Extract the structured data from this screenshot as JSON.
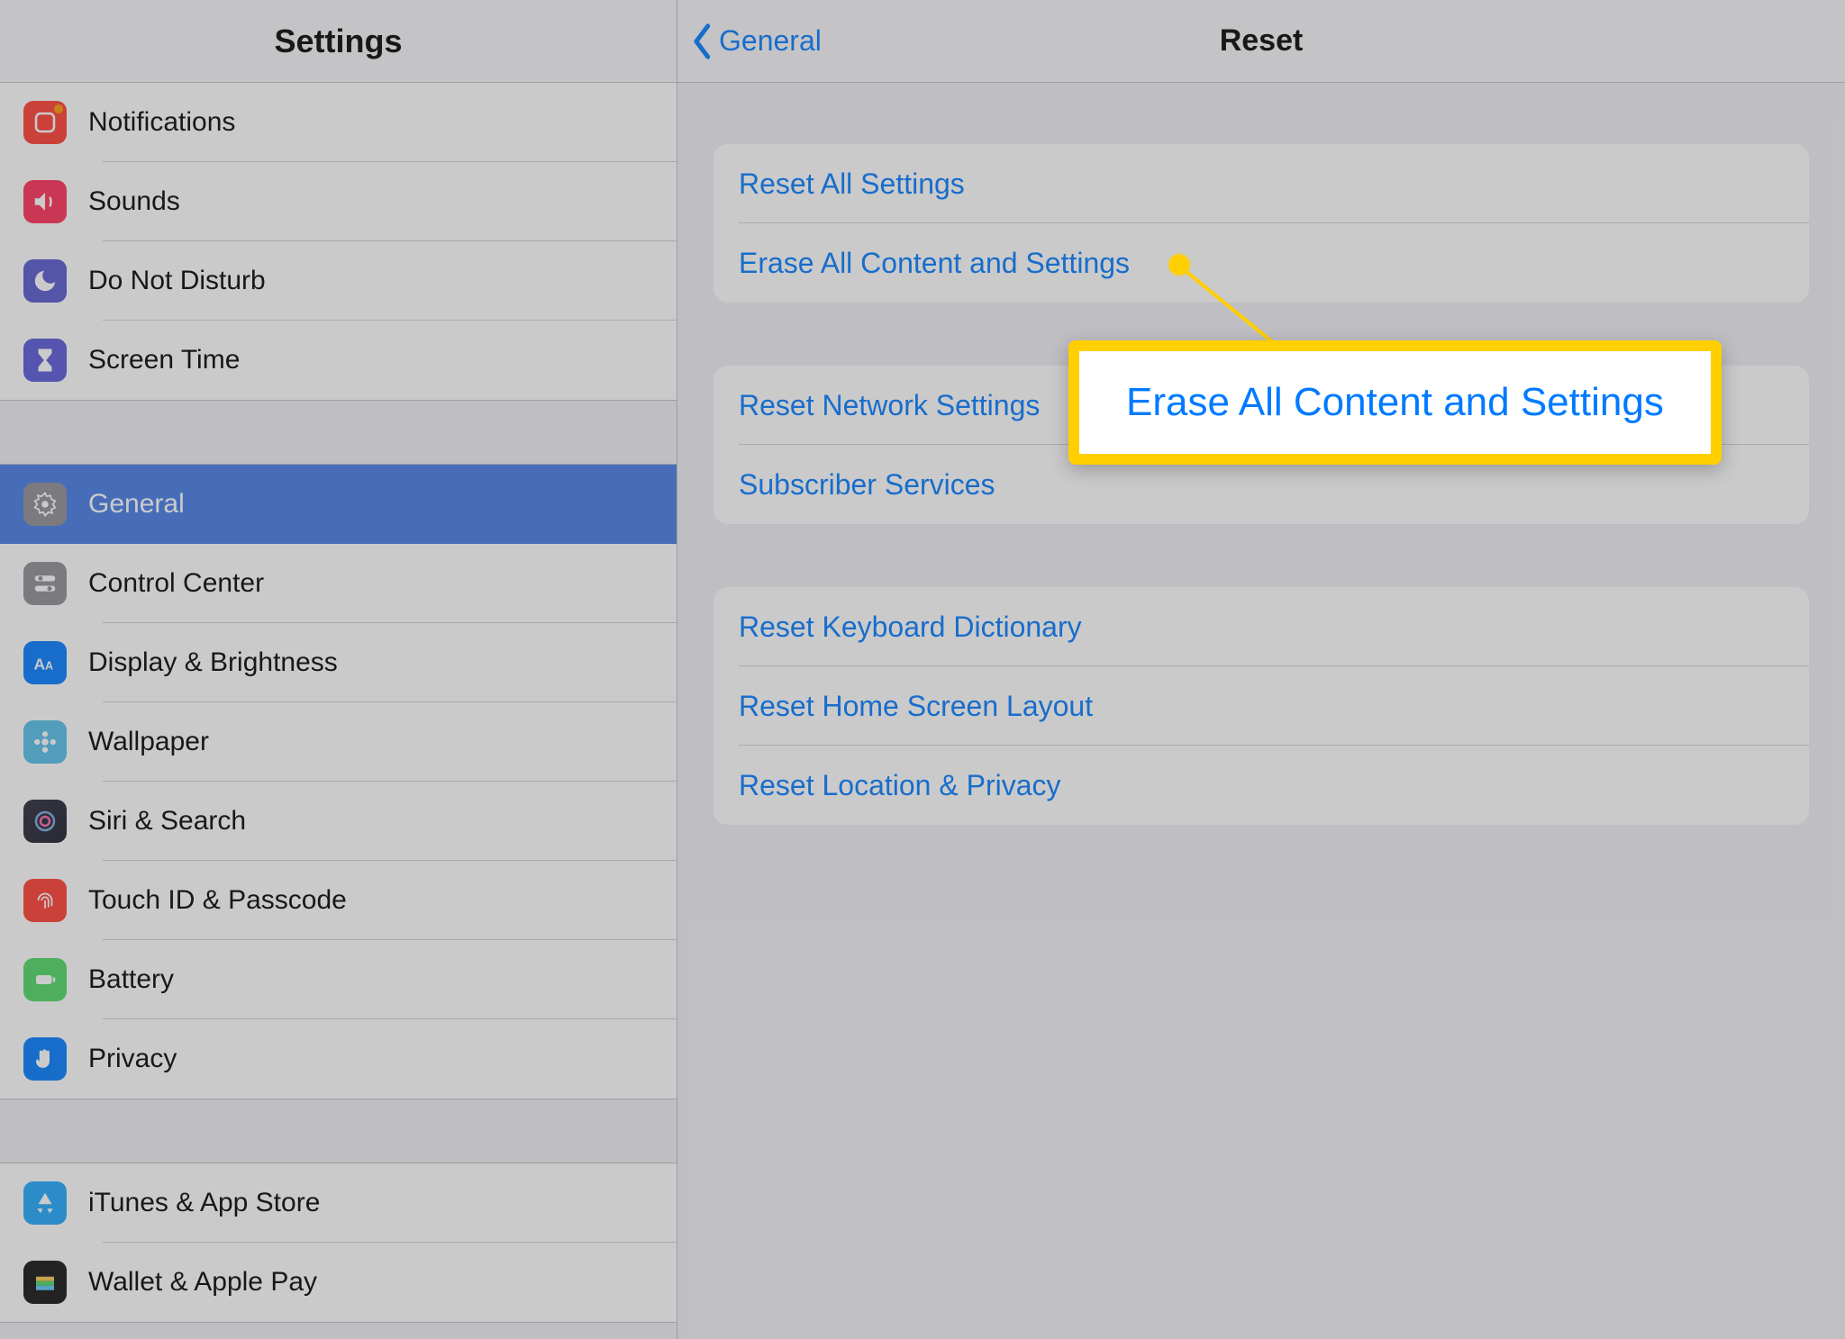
{
  "sidebar": {
    "title": "Settings",
    "group1": [
      {
        "label": "Notifications"
      },
      {
        "label": "Sounds"
      },
      {
        "label": "Do Not Disturb"
      },
      {
        "label": "Screen Time"
      }
    ],
    "group2": [
      {
        "label": "General"
      },
      {
        "label": "Control Center"
      },
      {
        "label": "Display & Brightness"
      },
      {
        "label": "Wallpaper"
      },
      {
        "label": "Siri & Search"
      },
      {
        "label": "Touch ID & Passcode"
      },
      {
        "label": "Battery"
      },
      {
        "label": "Privacy"
      }
    ],
    "group3": [
      {
        "label": "iTunes & App Store"
      },
      {
        "label": "Wallet & Apple Pay"
      }
    ]
  },
  "detail": {
    "back_label": "General",
    "title": "Reset",
    "group1": [
      "Reset All Settings",
      "Erase All Content and Settings"
    ],
    "group2": [
      "Reset Network Settings",
      "Subscriber Services"
    ],
    "group3": [
      "Reset Keyboard Dictionary",
      "Reset Home Screen Layout",
      "Reset Location & Privacy"
    ]
  },
  "callout": {
    "text": "Erase All Content and Settings"
  }
}
